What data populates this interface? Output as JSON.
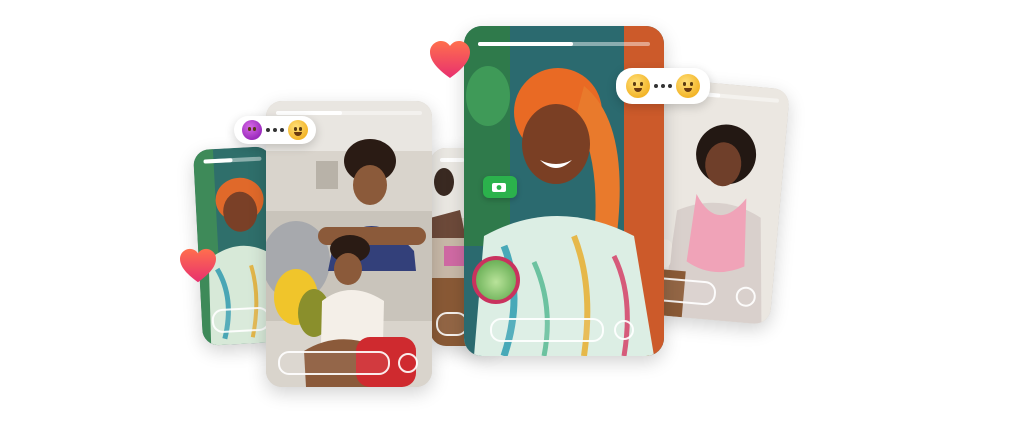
{
  "collage": {
    "cards": [
      {
        "id": "card-1",
        "progress": 0.5
      },
      {
        "id": "card-2",
        "progress": 0.45
      },
      {
        "id": "card-3",
        "progress": 0.5
      },
      {
        "id": "card-4",
        "progress": 0.55
      },
      {
        "id": "card-5",
        "progress": 0.6
      }
    ],
    "colors": {
      "heart_top": "#ff6f4d",
      "heart_bottom": "#e8306f",
      "chip": "#2bb24c",
      "sticker_ring": "#c9325e"
    }
  }
}
